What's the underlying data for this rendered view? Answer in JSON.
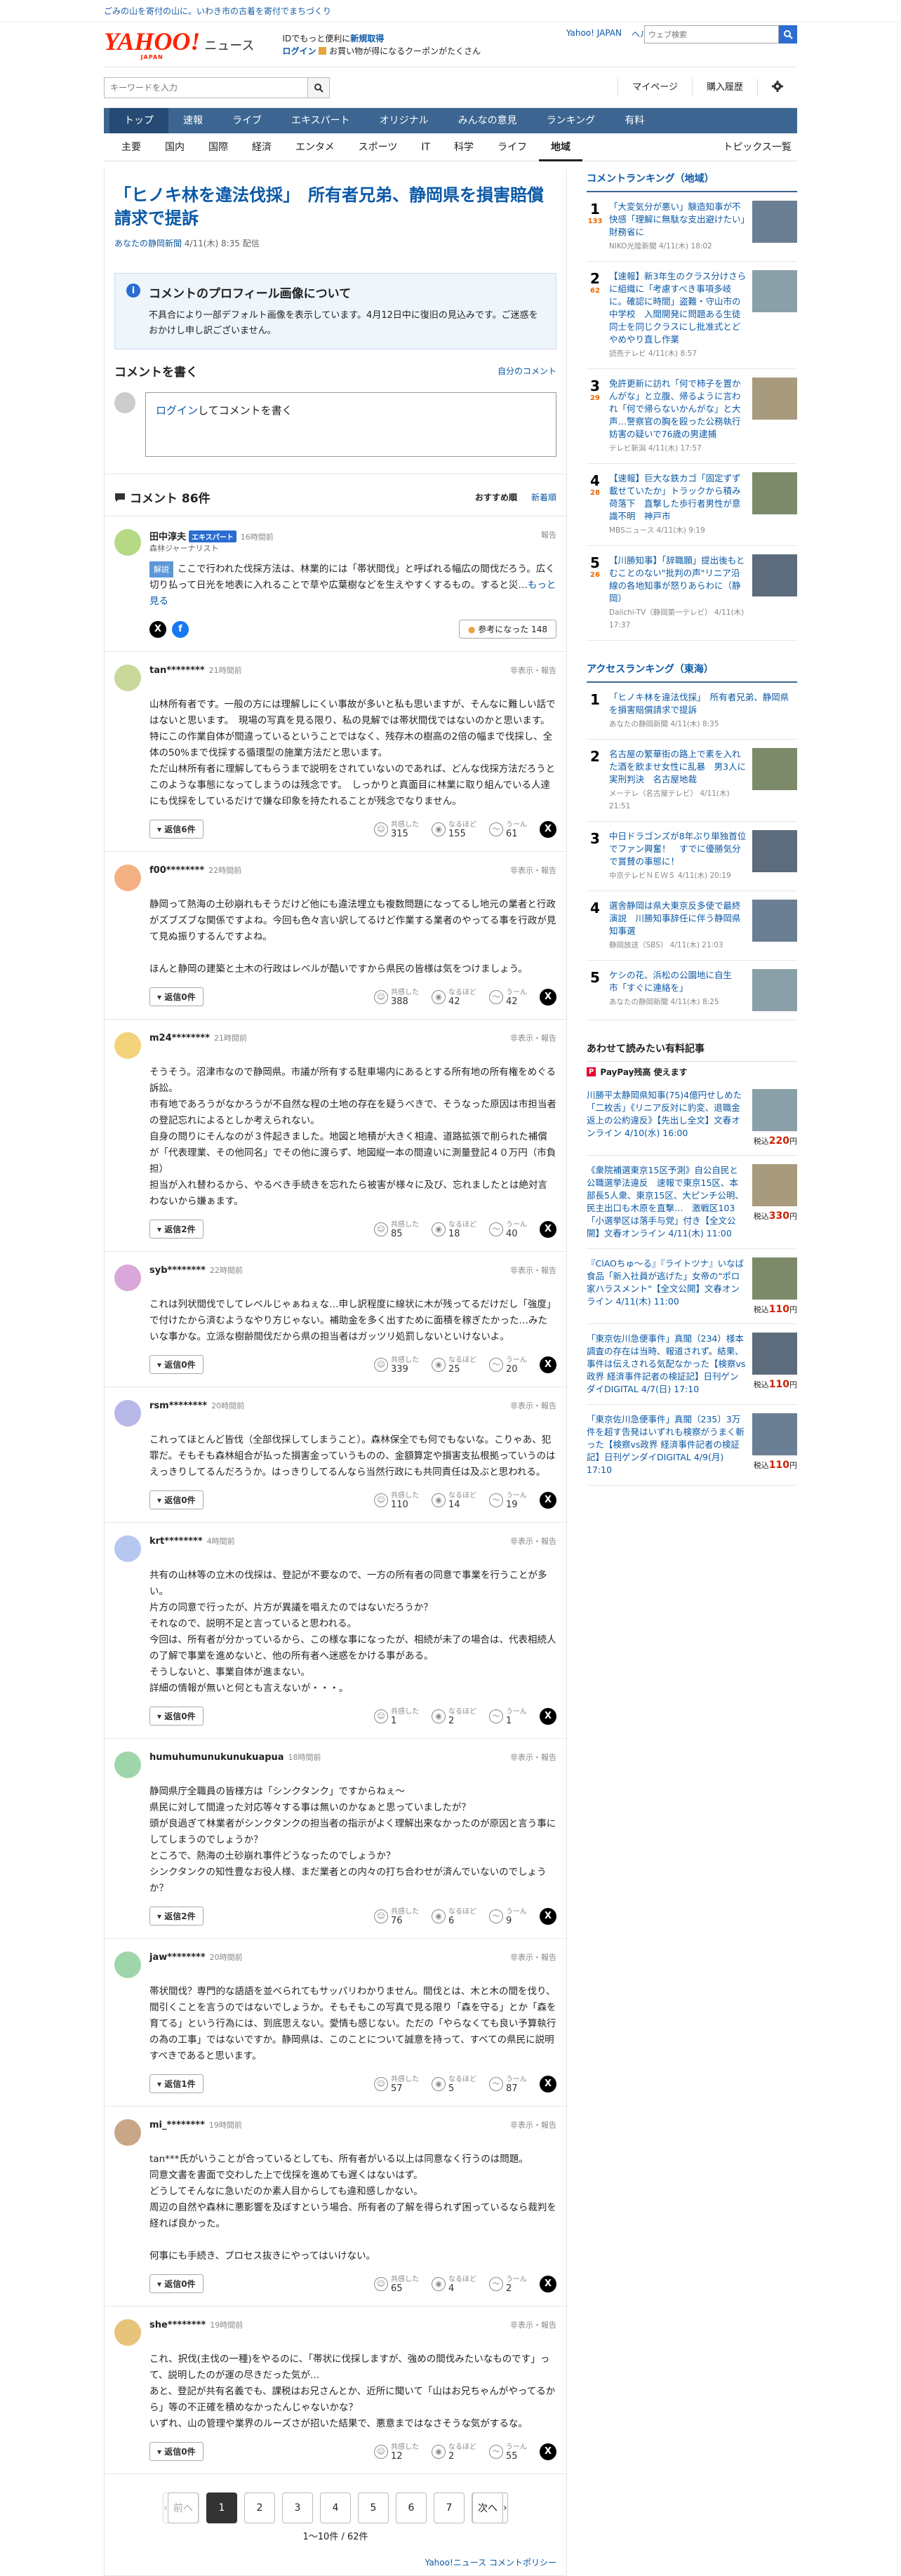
{
  "topbar": {
    "promo": "ごみの山を寄付の山に。いわき市の古着を寄付でまちづくり"
  },
  "header": {
    "logo_main": "YAHOO!",
    "logo_sub": "JAPAN",
    "logo_news": "ニュース",
    "promo_line1a": "IDでもっと便利に",
    "promo_line1b": "新規取得",
    "promo_line2a": "ログイン",
    "promo_line2b": "お買い物が得になるクーポンがたくさん",
    "link_yj": "Yahoo! JAPAN",
    "link_help": "ヘルプ",
    "web_search_placeholder": "ウェブ検索"
  },
  "searchrow": {
    "placeholder": "キーワードを入力",
    "mypage": "マイページ",
    "history": "購入履歴"
  },
  "gnav": [
    "トップ",
    "速報",
    "ライブ",
    "エキスパート",
    "オリジナル",
    "みんなの意見",
    "ランキング",
    "有料"
  ],
  "snav": [
    "主要",
    "国内",
    "国際",
    "経済",
    "エンタメ",
    "スポーツ",
    "IT",
    "科学",
    "ライフ",
    "地域"
  ],
  "snav_right": "トピックス一覧",
  "article": {
    "title": "「ヒノキ林を違法伐採」　所有者兄弟、静岡県を損害賠償請求で提訴",
    "source": "あなたの静岡新聞",
    "time": "4/11(木) 8:35 配信"
  },
  "notice": {
    "title": "コメントのプロフィール画像について",
    "body": "不具合により一部デフォルト画像を表示しています。4月12日中に復旧の見込みです。ご迷惑をおかけし申し訳ございません。"
  },
  "write": {
    "title": "コメントを書く",
    "own": "自分のコメント",
    "login": "ログイン",
    "prompt": "してコメントを書く"
  },
  "comments_head": {
    "title": "コメント 86件",
    "sort1": "おすすめ順",
    "sort2": "新着順"
  },
  "expert": {
    "name": "田中淳夫",
    "badge": "エキスパート",
    "time": "16時間前",
    "title": "森林ジャーナリスト",
    "label": "解説",
    "body": "ここで行われた伐採方法は、林業的には「帯状間伐」と呼ばれる幅広の間伐だろう。広く切り払って日光を地表に入れることで草や広葉樹などを生えやすくするもの。すると災…",
    "more": "もっと見る",
    "useful": "参考になった",
    "useful_count": "148",
    "report": "報告"
  },
  "comment_labels": {
    "reply_suffix": "件",
    "reply_prefix": "返信",
    "react1": "共感した",
    "react2": "なるほど",
    "react3": "うーん",
    "hide": "非表示・報告"
  },
  "comments": [
    {
      "name": "tan********",
      "time": "21時間前",
      "body": "山林所有者です。一般の方には理解しにくい事故が多いと私も思いますが、そんなに難しい話ではないと思います。　現場の写真を見る限り、私の見解では帯状間伐ではないのかと思います。　特にこの作業自体が間違っているということではなく、残存木の樹高の2倍の幅まで伐採し、全体の50%まで伐採する循環型の施業方法だと思います。\nただ山林所有者に理解してもらうまで説明をされていないのであれば、どんな伐採方法だろうとこのような事態になってしまうのは残念です。　しっかりと真面目に林業に取り組んでいる人達にも伐採をしているだけで嫌な印象を持たれることが残念でなりません。",
      "replies": "6",
      "r1": "315",
      "r2": "155",
      "r3": "61"
    },
    {
      "name": "f00********",
      "time": "22時間前",
      "body": "静岡って熱海の土砂崩れもそうだけど他にも違法埋立も複数問題になってるし地元の業者と行政がズブズブな関係ですよね。今回も色々言い訳してるけど作業する業者のやってる事を行政が見て見ぬ振りするんですよね。\n\nほんと静岡の建築と土木の行政はレベルが酷いですから県民の皆様は気をつけましょう。",
      "replies": "0",
      "r1": "388",
      "r2": "42",
      "r3": "42"
    },
    {
      "name": "m24********",
      "time": "21時間前",
      "body": "そうそう。沼津市なので静岡県。市議が所有する駐車場内にあるとする所有地の所有権をめぐる訴訟。\n市有地であろうがなかろうが不自然な程の土地の存在を疑うべきで、そうなった原因は市担当者の登記忘れによるとしか考えられない。\n自身の問りにそんなのが３件起きました。地図と地積が大きく相違、道路拡張で削られた補償が「代表理業、その他同名」でその他に渡らず、地図縦一本の間違いに測量登記４０万円（市負担）\n担当が入れ替わるから、やるべき手続きを忘れたら被害が様々に及び、忘れましたとは絶対言わないから嫌ぁます。",
      "replies": "2",
      "r1": "85",
      "r2": "18",
      "r3": "40"
    },
    {
      "name": "syb********",
      "time": "22時間前",
      "body": "これは列状間伐でしてレベルじゃぁねぇな…申し訳程度に線状に木が残ってるだけだし「強度」で付けたから済むようなやり方じゃない。補助金を多く出すために面積を稼ぎたかった…みたいな事かな。立派な樹齢間伐だから県の担当者はガッツリ処罰しないといけないよ。",
      "replies": "0",
      "r1": "339",
      "r2": "25",
      "r3": "20"
    },
    {
      "name": "rsm********",
      "time": "20時間前",
      "body": "これってほとんど皆伐（全部伐採してしまうこと）。森林保全でも何でもないな。こりゃあ、犯罪だ。そもそも森林組合が払った損害金っていうものの、金額算定や損害支払根拠っていうのはえっきりしてるんだろうか。はっきりしてるんなら当然行政にも共同責任は及ぶと思われる。",
      "replies": "0",
      "r1": "110",
      "r2": "14",
      "r3": "19"
    },
    {
      "name": "krt********",
      "time": "4時間前",
      "body": "共有の山林等の立木の伐採は、登記が不要なので、一方の所有者の同意で事業を行うことが多い。\n片方の同意で行ったが、片方が異議を唱えたのではないだろうか？\nそれなので、説明不足と言っていると思われる。\n今回は、所有者が分かっているから、この様な事になったが、相続が未了の場合は、代表相続人の了解で事業を進めないと、他の所有者へ迷惑をかける事がある。\nそうしないと、事業自体が進まない。\n詳細の情報が無いと何とも言えないが・・・。",
      "replies": "0",
      "r1": "1",
      "r2": "2",
      "r3": "1"
    },
    {
      "name": "humuhumunukunukuapua",
      "time": "18時間前",
      "body": "静岡県庁全職員の皆様方は「シンクタンク」ですからねぇ～\n県民に対して間違った対応等々する事は無いのかなぁと思っていましたが？\n頭が良過ぎて林業者がシンクタンクの担当者の指示がよく理解出来なかったのが原因と言う事にしてしまうのでしょうか？\nところで、熱海の土砂崩れ事件どうなったのでしょうか？\nシンクタンクの知性豊なお役人様、まだ業者との内々の打ち合わせが済んでいないのでしょうか？",
      "replies": "2",
      "r1": "76",
      "r2": "6",
      "r3": "9"
    },
    {
      "name": "jaw********",
      "time": "20時間前",
      "body": "帯状間伐？専門的な語語を並べられてもサッパリわかりません。間伐とは、木と木の間を伐り、間引くことを言うのではないでしょうか。そもそもこの写真で見る限り「森を守る」とか「森を育てる」という行為には、到底思えない。愛情も感じない。ただの「やらなくても良い予算執行の為の工事」ではないですか。静岡県は、このことについて誠意を持って、すべての県民に説明すべきであると思います。",
      "replies": "1",
      "r1": "57",
      "r2": "5",
      "r3": "87"
    },
    {
      "name": "mi_********",
      "time": "19時間前",
      "body": "tan***氏がいうことが合っているとしても、所有者がいる以上は同意なく行うのは問題。\n同意文書を書面で交わした上で伐採を進めても遅くはないはず。\nどうしてそんなに急いだのか素人目からしても違和感しかない。\n周辺の自然や森林に悪影響を及ぼすという場合、所有者の了解を得られず困っているなら裁判を経れば良かった。\n\n何事にも手続き、プロセス抜きにやってはいけない。",
      "replies": "0",
      "r1": "65",
      "r2": "4",
      "r3": "2"
    },
    {
      "name": "she********",
      "time": "19時間前",
      "body": "これ、択伐(主伐の一種)をやるのに、「帯状に伐採しますが、強めの間伐みたいなものです」って、説明したのが運の尽きだった気が…\nあと、登記が共有名義でも、課税はお兄さんとか、近所に聞いて「山はお兄ちゃんがやってるから」等の不正確を積めなかったんじゃないかな？\nいずれ、山の管理や業界のルーズさが招いた結果で、悪意まではなさそうな気がするな。",
      "replies": "0",
      "r1": "12",
      "r2": "2",
      "r3": "55"
    }
  ],
  "pager": {
    "prev": "前へ",
    "pages": [
      "1",
      "2",
      "3",
      "4",
      "5",
      "6",
      "7"
    ],
    "next": "次へ",
    "total": "1〜10件 / 62件"
  },
  "policy": "Yahoo!ニュース コメントポリシー",
  "side": {
    "rank_title": "コメントランキング（地域）",
    "ranking": [
      {
        "num": "1",
        "cmt": "133",
        "text": "「大変気分が悪い」験造知事が不快感「理解に無駄な支出避けたい」財務省に",
        "src": "NIKO光陸新聞 4/11(木) 18:02"
      },
      {
        "num": "2",
        "cmt": "62",
        "text": "【速報】新3年生のクラス分けさらに組織に「考慮すべき事項多岐に。確認に時間」盗難・守山市の中学校　入間開発に問題ある生徒同士を同じクラスにし批准式とどやめやり直し作業",
        "src": "読売テレビ 4/11(木) 8:57"
      },
      {
        "num": "3",
        "cmt": "29",
        "text": "免許更新に訪れ「何で柿子を置かんがな」と立腹、帰るように言われ「何で帰らないかんがな」と大声…警察官の胸を殴った公務執行妨害の疑いで76歳の男逮捕",
        "src": "テレビ新潟 4/11(木) 17:57"
      },
      {
        "num": "4",
        "cmt": "28",
        "text": "【速報】巨大な鉄カゴ「固定ずず載せていたか」トラックから積み荷落下　直撃した歩行者男性が意識不明　神戸市",
        "src": "MBSニュース 4/11(木) 9:19"
      },
      {
        "num": "5",
        "cmt": "26",
        "text": "【川勝知事】「辞職願」提出後もとむことのない\"批判の声\"リニア沿線の各地知事が怒りあらわに（静岡）",
        "src": "Daiichi-TV（静岡第一テレビ） 4/11(木) 17:37"
      }
    ],
    "access_title": "アクセスランキング（東海）",
    "access": [
      {
        "num": "1",
        "text": "「ヒノキ林を違法伐採」　所有者兄弟、静岡県を損害賠償請求で提訴",
        "src": "あなたの静岡新聞 4/11(木) 8:35"
      },
      {
        "num": "2",
        "text": "名古屋の繁華街の路上で素を入れた酒を飲ませ女性に乱暴　男3人に実刑判決　名古屋地裁",
        "src": "メーテレ（名古屋テレビ） 4/11(木) 21:51"
      },
      {
        "num": "3",
        "text": "中日ドラゴンズが8年ぶり単独首位でファン興奮！　すでに優勝気分で賞賛の事態に！",
        "src": "中京テレビＮＥＷＳ 4/11(木) 20:19"
      },
      {
        "num": "4",
        "text": "選舎静岡は県大東京反多使で最終演説　川勝知事辞任に伴う静岡県知事選",
        "src": "静岡放送（SBS） 4/11(木) 21:03"
      },
      {
        "num": "5",
        "text": "ケシの花、浜松の公園地に自生　市「すぐに連絡を」",
        "src": "あなたの静岡新聞 4/11(木) 8:25"
      }
    ],
    "pay_title": "あわせて読みたい有料記事",
    "pay_label": "PayPay残高 使えます",
    "pay": [
      {
        "text": "川勝平太静岡県知事(75)4億円せしめた「二枚舌」《リニア反対に豹変、退職金返上の公約違反》【先出し全文】",
        "src": "文春オンライン 4/10(水) 16:00",
        "price": "220"
      },
      {
        "text": "《衆院補選東京15区予測》自公自民と公職選挙法違反　速報で東京15区、本部長5人衆、東京15区、大ピンチ公明、民主出口も木原を直撃…　激戦区103「小選挙区は落手与党」付き【全文公開】",
        "src": "文春オンライン 4/11(木) 11:00",
        "price": "330"
      },
      {
        "text": "『ClAOちゅ～る』『ライトツナ』いなば食品「新入社員が逃げた」女帝の\"ポロ家ハラスメント\"【全文公開】",
        "src": "文春オンライン 4/11(木) 11:00",
        "price": "110"
      },
      {
        "text": "「東京佐川急便事件」真聞（234）様本調査の存在は当時、報道されず。結果、事件は伝えされる気配なかった【検察vs政界 経済事件記者の検証記】",
        "src": "日刊ゲンダイDIGITAL 4/7(日) 17:10",
        "price": "110"
      },
      {
        "text": "「東京佐川急便事件」真聞（235）3万件を超す告発はいずれも検察がうまく斬った【検察vs政界 経済事件記者の検証記】",
        "src": "日刊ゲンダイDIGITAL 4/9(月) 17:10",
        "price": "110"
      },
      {
        "text_price_prefix": "税込",
        "text_price_suffix": "円"
      }
    ]
  },
  "colors": {
    "link": "#0b59a6",
    "nav_bg": "#3c6691",
    "logo": "#ff2200"
  }
}
